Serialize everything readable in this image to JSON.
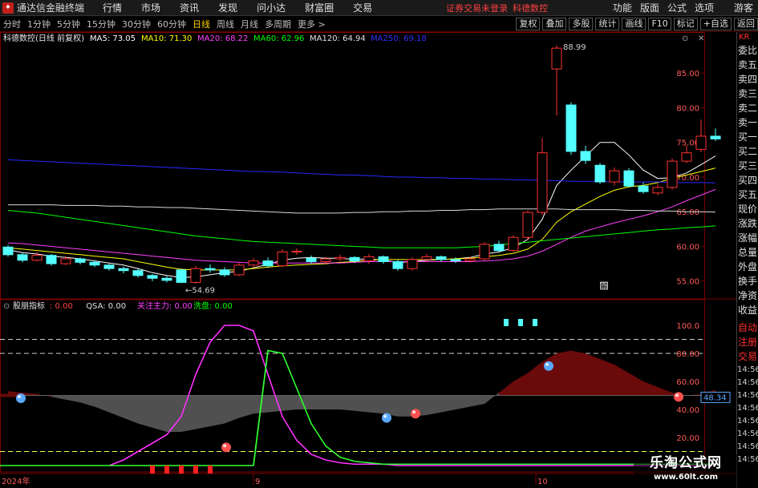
{
  "window": {
    "app_title": "通达信金融终端",
    "menu": [
      "行情",
      "市场",
      "资讯",
      "发现",
      "问小达",
      "财富圈",
      "交易"
    ],
    "warning": "证券交易未登录",
    "stock_name_top": "科德数控",
    "right_menu": [
      "功能",
      "版面",
      "公式",
      "选项"
    ],
    "guest": "游客"
  },
  "toolbar": {
    "periods": [
      "分时",
      "1分钟",
      "5分钟",
      "15分钟",
      "30分钟",
      "60分钟",
      "日线",
      "周线",
      "月线",
      "多周期",
      "更多 >"
    ],
    "active_period": "日线",
    "tools": [
      "复权",
      "叠加",
      "多股",
      "统计",
      "画线",
      "F10",
      "标记",
      "+自选",
      "返回"
    ]
  },
  "main_panel": {
    "title": "科德数控(日线 前复权)",
    "ma": [
      {
        "label": "MA5: 73.05",
        "color": "#ffffff"
      },
      {
        "label": "MA10: 71.30",
        "color": "#ffff00"
      },
      {
        "label": "MA20: 68.22",
        "color": "#ff40ff"
      },
      {
        "label": "MA60: 62.96",
        "color": "#00ff00"
      },
      {
        "label": "MA120: 64.94",
        "color": "#e0e0e0"
      },
      {
        "label": "MA250: 69.18",
        "color": "#3030ff"
      }
    ],
    "y_ticks": [
      "85.00",
      "80.00",
      "75.00",
      "70.00",
      "65.00",
      "60.00",
      "55.00"
    ],
    "high_label": "88.99",
    "low_label": "54.69",
    "marker_label": "解"
  },
  "indicator_panel": {
    "title": "股朋指标",
    "values": [
      {
        "label": ": 0.00",
        "color": "#ff4040"
      },
      {
        "label": "QSA: 0.00",
        "color": "#e0e0e0"
      },
      {
        "label": "关注主力: 0.00",
        "color": "#ff40ff"
      },
      {
        "label": "洗盘: 0.00",
        "color": "#00ff00"
      }
    ],
    "y_ticks": [
      "100.0",
      "80.00",
      "60.00",
      "40.00",
      "20.00"
    ],
    "current_value": "48.34"
  },
  "date_axis": {
    "labels": [
      "2024年",
      "9",
      "10"
    ]
  },
  "side_panel": {
    "code": "KR",
    "items": [
      "委比",
      "卖五",
      "卖四",
      "卖三",
      "卖二",
      "卖一",
      "买一",
      "买二",
      "买三",
      "买四",
      "买五",
      "现价",
      "涨跌",
      "涨幅",
      "总量",
      "外盘",
      "换手",
      "净资",
      "收益"
    ],
    "items2": [
      "自动",
      "注册",
      "交易"
    ],
    "times": [
      "14:56",
      "14:56",
      "14:56",
      "14:56",
      "14:56",
      "14:56",
      "14:56",
      "14:56"
    ]
  },
  "watermark": {
    "line1": "乐淘公式网",
    "line2": "www.60lt.com"
  },
  "colors": {
    "up": "#ff3232",
    "down": "#54ffff",
    "background": "#000000",
    "grid": "#7a0000"
  },
  "chart_data": {
    "type": "candlestick",
    "candles": [
      [
        59.9,
        58.8,
        60.2,
        58.5
      ],
      [
        58.8,
        58.0,
        59.1,
        57.7
      ],
      [
        58.0,
        58.7,
        59.2,
        57.8
      ],
      [
        58.7,
        57.5,
        58.9,
        57.2
      ],
      [
        57.5,
        58.2,
        58.6,
        57.3
      ],
      [
        58.2,
        57.7,
        58.4,
        57.4
      ],
      [
        57.7,
        57.3,
        58.0,
        57.0
      ],
      [
        57.3,
        56.8,
        57.5,
        56.5
      ],
      [
        56.8,
        56.5,
        57.1,
        56.1
      ],
      [
        56.5,
        55.8,
        56.8,
        55.5
      ],
      [
        55.8,
        55.4,
        56.0,
        55.0
      ],
      [
        55.4,
        55.1,
        55.7,
        54.8
      ],
      [
        56.6,
        54.8,
        56.8,
        54.69
      ],
      [
        54.8,
        56.8,
        57.2,
        54.6
      ],
      [
        56.8,
        56.6,
        57.4,
        56.2
      ],
      [
        56.6,
        55.9,
        57.0,
        55.6
      ],
      [
        55.9,
        57.3,
        57.6,
        55.7
      ],
      [
        57.3,
        57.9,
        58.3,
        57.0
      ],
      [
        57.9,
        57.2,
        58.4,
        56.9
      ],
      [
        57.2,
        59.2,
        59.6,
        57.0
      ],
      [
        59.2,
        59.3,
        59.7,
        58.8
      ],
      [
        58.3,
        57.8,
        58.7,
        57.5
      ],
      [
        57.8,
        58.2,
        58.5,
        57.5
      ],
      [
        58.2,
        58.4,
        58.8,
        57.9
      ],
      [
        58.4,
        57.9,
        58.6,
        57.6
      ],
      [
        57.9,
        58.5,
        58.9,
        57.5
      ],
      [
        58.5,
        57.8,
        58.7,
        57.5
      ],
      [
        57.8,
        56.8,
        58.1,
        56.5
      ],
      [
        56.8,
        58.1,
        58.4,
        56.5
      ],
      [
        58.1,
        58.5,
        58.9,
        57.8
      ],
      [
        58.5,
        58.1,
        58.7,
        57.8
      ],
      [
        58.1,
        57.9,
        58.4,
        57.6
      ],
      [
        57.9,
        58.2,
        58.5,
        57.7
      ],
      [
        58.2,
        60.3,
        60.6,
        58.0
      ],
      [
        60.3,
        59.4,
        60.8,
        59.1
      ],
      [
        59.4,
        61.3,
        61.6,
        59.2
      ],
      [
        61.3,
        64.9,
        65.2,
        61.0
      ],
      [
        64.9,
        73.5,
        75.6,
        64.5
      ],
      [
        85.6,
        88.6,
        88.99,
        78.9
      ],
      [
        80.4,
        73.7,
        80.8,
        73.2
      ],
      [
        73.7,
        72.4,
        74.5,
        71.9
      ],
      [
        71.7,
        69.3,
        72.0,
        69.0
      ],
      [
        69.3,
        70.9,
        71.4,
        68.8
      ],
      [
        70.9,
        68.7,
        71.3,
        68.5
      ],
      [
        68.7,
        67.9,
        69.2,
        67.6
      ],
      [
        67.7,
        68.5,
        69.0,
        67.4
      ],
      [
        68.5,
        72.3,
        72.7,
        68.2
      ],
      [
        72.3,
        73.5,
        74.6,
        72.0
      ],
      [
        74.0,
        75.9,
        78.3,
        73.6
      ],
      [
        75.9,
        75.5,
        77.0,
        75.2
      ]
    ],
    "ma": {
      "MA5": [
        59.5,
        59.1,
        58.9,
        58.6,
        58.4,
        58.2,
        57.9,
        57.6,
        57.3,
        56.8,
        56.2,
        55.8,
        55.5,
        55.6,
        55.9,
        56.2,
        56.4,
        56.9,
        57.4,
        58.0,
        58.3,
        58.4,
        58.3,
        58.3,
        58.1,
        58.2,
        58.0,
        57.7,
        57.8,
        58.0,
        58.1,
        58.2,
        58.4,
        58.9,
        59.2,
        59.8,
        61.0,
        63.9,
        68.8,
        71.0,
        73.0,
        75.0,
        75.0,
        73.2,
        71.0,
        69.8,
        69.9,
        70.6,
        71.8,
        73.05
      ],
      "MA10": [
        59.8,
        59.6,
        59.4,
        59.2,
        59.0,
        58.8,
        58.6,
        58.4,
        58.2,
        57.8,
        57.4,
        57.0,
        56.7,
        56.6,
        56.6,
        56.6,
        56.6,
        56.8,
        57.0,
        57.2,
        57.3,
        57.4,
        57.5,
        57.7,
        57.8,
        58.0,
        58.1,
        58.1,
        58.1,
        58.1,
        58.1,
        58.2,
        58.3,
        58.5,
        58.7,
        59.0,
        59.6,
        61.0,
        63.5,
        65.0,
        66.1,
        67.2,
        68.1,
        68.6,
        68.8,
        69.2,
        69.8,
        70.3,
        70.8,
        71.3
      ],
      "MA20": [
        60.5,
        60.4,
        60.2,
        60.0,
        59.8,
        59.6,
        59.4,
        59.2,
        59.0,
        58.8,
        58.6,
        58.4,
        58.2,
        58.0,
        57.9,
        57.8,
        57.7,
        57.6,
        57.6,
        57.6,
        57.6,
        57.6,
        57.6,
        57.6,
        57.7,
        57.8,
        57.8,
        57.8,
        57.8,
        57.8,
        57.8,
        57.8,
        57.8,
        57.9,
        58.0,
        58.2,
        58.6,
        59.3,
        60.3,
        61.3,
        62.2,
        62.8,
        63.4,
        63.9,
        64.4,
        65.0,
        65.7,
        66.6,
        67.4,
        68.22
      ],
      "MA60": [
        65.2,
        65.0,
        64.8,
        64.5,
        64.2,
        63.9,
        63.6,
        63.3,
        63.0,
        62.7,
        62.4,
        62.1,
        61.8,
        61.5,
        61.3,
        61.1,
        60.9,
        60.7,
        60.6,
        60.5,
        60.4,
        60.3,
        60.2,
        60.1,
        60.0,
        59.9,
        59.8,
        59.8,
        59.8,
        59.8,
        59.8,
        59.8,
        59.9,
        60.0,
        60.2,
        60.4,
        60.6,
        60.8,
        61.0,
        61.2,
        61.4,
        61.6,
        61.8,
        62.0,
        62.2,
        62.4,
        62.5,
        62.7,
        62.8,
        62.96
      ],
      "MA120": [
        66.0,
        66.0,
        66.0,
        66.0,
        65.9,
        65.9,
        65.9,
        65.8,
        65.8,
        65.7,
        65.7,
        65.6,
        65.6,
        65.5,
        65.4,
        65.3,
        65.2,
        65.1,
        65.0,
        64.9,
        64.8,
        64.8,
        64.8,
        64.8,
        64.9,
        64.9,
        65.0,
        65.0,
        65.1,
        65.1,
        65.2,
        65.2,
        65.3,
        65.3,
        65.4,
        65.4,
        65.4,
        65.4,
        65.4,
        65.3,
        65.3,
        65.3,
        65.3,
        65.2,
        65.2,
        65.1,
        65.1,
        65.0,
        65.0,
        64.94
      ],
      "MA250": [
        72.5,
        72.4,
        72.3,
        72.2,
        72.1,
        72.0,
        71.9,
        71.8,
        71.7,
        71.6,
        71.5,
        71.4,
        71.3,
        71.2,
        71.1,
        71.0,
        70.9,
        70.8,
        70.8,
        70.7,
        70.6,
        70.5,
        70.4,
        70.3,
        70.3,
        70.2,
        70.1,
        70.0,
        70.0,
        69.9,
        69.9,
        69.8,
        69.8,
        69.7,
        69.7,
        69.6,
        69.6,
        69.5,
        69.5,
        69.4,
        69.4,
        69.4,
        69.3,
        69.3,
        69.3,
        69.3,
        69.2,
        69.2,
        69.2,
        69.18
      ]
    },
    "indicator": {
      "QSA": [
        53,
        52,
        51,
        49,
        47,
        45,
        42,
        38,
        34,
        30,
        27,
        24,
        24,
        26,
        28,
        30,
        34,
        37,
        38,
        39,
        40,
        40,
        40,
        40,
        39,
        38,
        37,
        35,
        35,
        36,
        38,
        40,
        42,
        44,
        52,
        60,
        66,
        74,
        80,
        82,
        80,
        76,
        72,
        66,
        60,
        56,
        52,
        50,
        51,
        54
      ],
      "zhuli": [
        0,
        0,
        0,
        0,
        0,
        0,
        0,
        0,
        4,
        10,
        16,
        22,
        35,
        65,
        88,
        100,
        100,
        96,
        65,
        35,
        18,
        8,
        4,
        2,
        1,
        1,
        1,
        0,
        0,
        0,
        0,
        0,
        0,
        0,
        0,
        0,
        0,
        0,
        0,
        0,
        0,
        0,
        0,
        0,
        0,
        0,
        0,
        0,
        0,
        0
      ],
      "xipan": [
        0,
        0,
        0,
        0,
        0,
        0,
        0,
        0,
        0,
        0,
        0,
        0,
        0,
        0,
        0,
        0,
        0,
        0,
        82,
        80,
        55,
        30,
        14,
        6,
        3,
        2,
        1,
        1,
        1,
        1,
        1,
        1,
        1,
        1,
        1,
        1,
        1,
        1,
        1,
        1,
        1,
        1,
        1,
        1,
        1,
        1,
        1,
        1,
        1,
        1
      ],
      "ylim": [
        0,
        100
      ]
    },
    "ylim": [
      53,
      90
    ]
  }
}
